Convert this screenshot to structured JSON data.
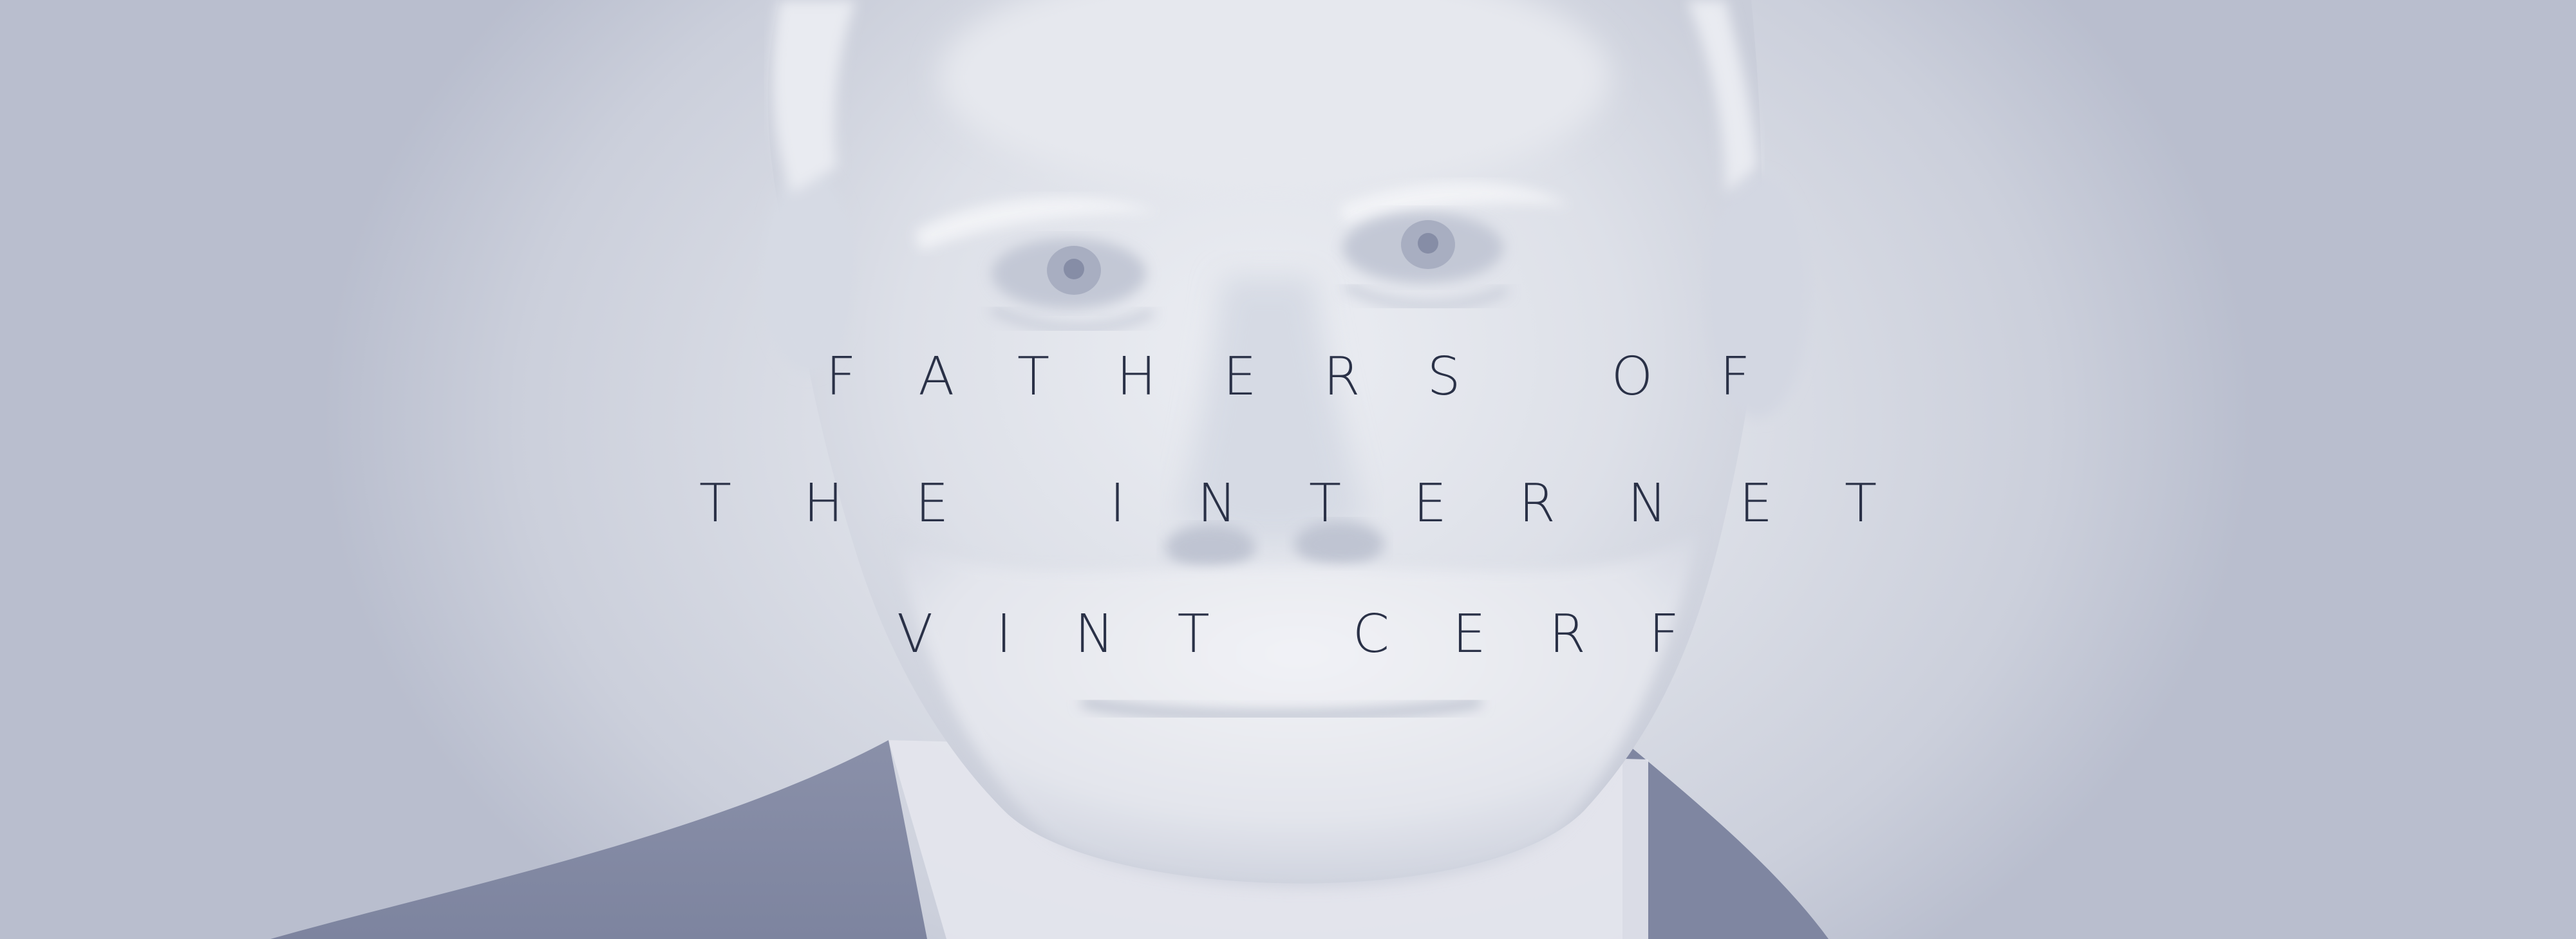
{
  "headline": {
    "line1": "FATHERS OF",
    "line2": "THE INTERNET",
    "line3": "VINT CERF"
  },
  "colors": {
    "background": "#d3d7e1",
    "text": "#2a3147",
    "tint": "#8d93ad"
  }
}
